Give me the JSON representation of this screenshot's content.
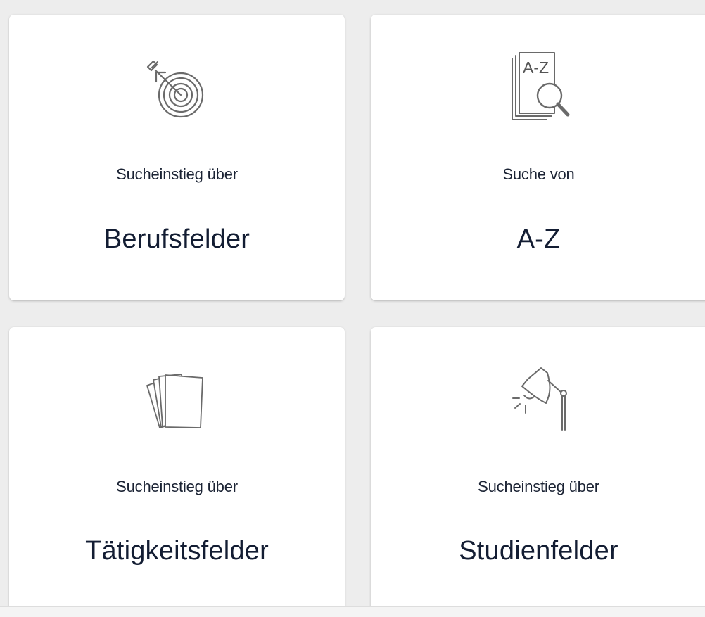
{
  "cards": [
    {
      "icon": "target-dart-icon",
      "subtitle": "Sucheinstieg über",
      "title": "Berufsfelder"
    },
    {
      "icon": "a-z-search-icon",
      "subtitle": "Suche von",
      "title": "A-Z",
      "icon_text": "A-Z"
    },
    {
      "icon": "card-stack-icon",
      "subtitle": "Sucheinstieg über",
      "title": "Tätigkeitsfelder"
    },
    {
      "icon": "desk-lamp-icon",
      "subtitle": "Sucheinstieg über",
      "title": "Studienfelder"
    }
  ],
  "colors": {
    "background": "#ededed",
    "card": "#ffffff",
    "text": "#131d33",
    "icon_stroke": "#6b6b6b"
  }
}
